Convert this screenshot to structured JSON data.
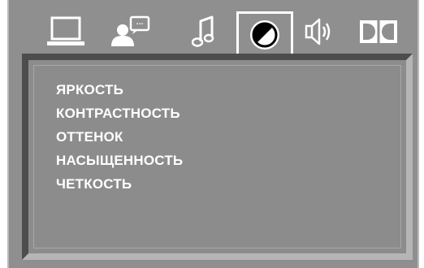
{
  "tabs": [
    {
      "icon": "laptop-icon",
      "active": false
    },
    {
      "icon": "person-speech-icon",
      "active": false,
      "bubble_text": "···"
    },
    {
      "icon": "music-note-icon",
      "active": false
    },
    {
      "icon": "contrast-icon",
      "active": true
    },
    {
      "icon": "speaker-icon",
      "active": false
    },
    {
      "icon": "dolby-icon",
      "active": false
    }
  ],
  "menu": {
    "items": [
      {
        "label": "ЯРКОСТЬ"
      },
      {
        "label": "КОНТРАСТНОСТЬ"
      },
      {
        "label": "ОТТЕНОК"
      },
      {
        "label": "НАСЫЩЕННОСТЬ"
      },
      {
        "label": "ЧЕТКОСТЬ"
      }
    ]
  },
  "colors": {
    "background": "#8f8f8f",
    "text": "#ffffff",
    "icon": "#ffffff",
    "panel_shadow": "#4d4d4d",
    "panel_highlight": "#b5b5b5"
  }
}
